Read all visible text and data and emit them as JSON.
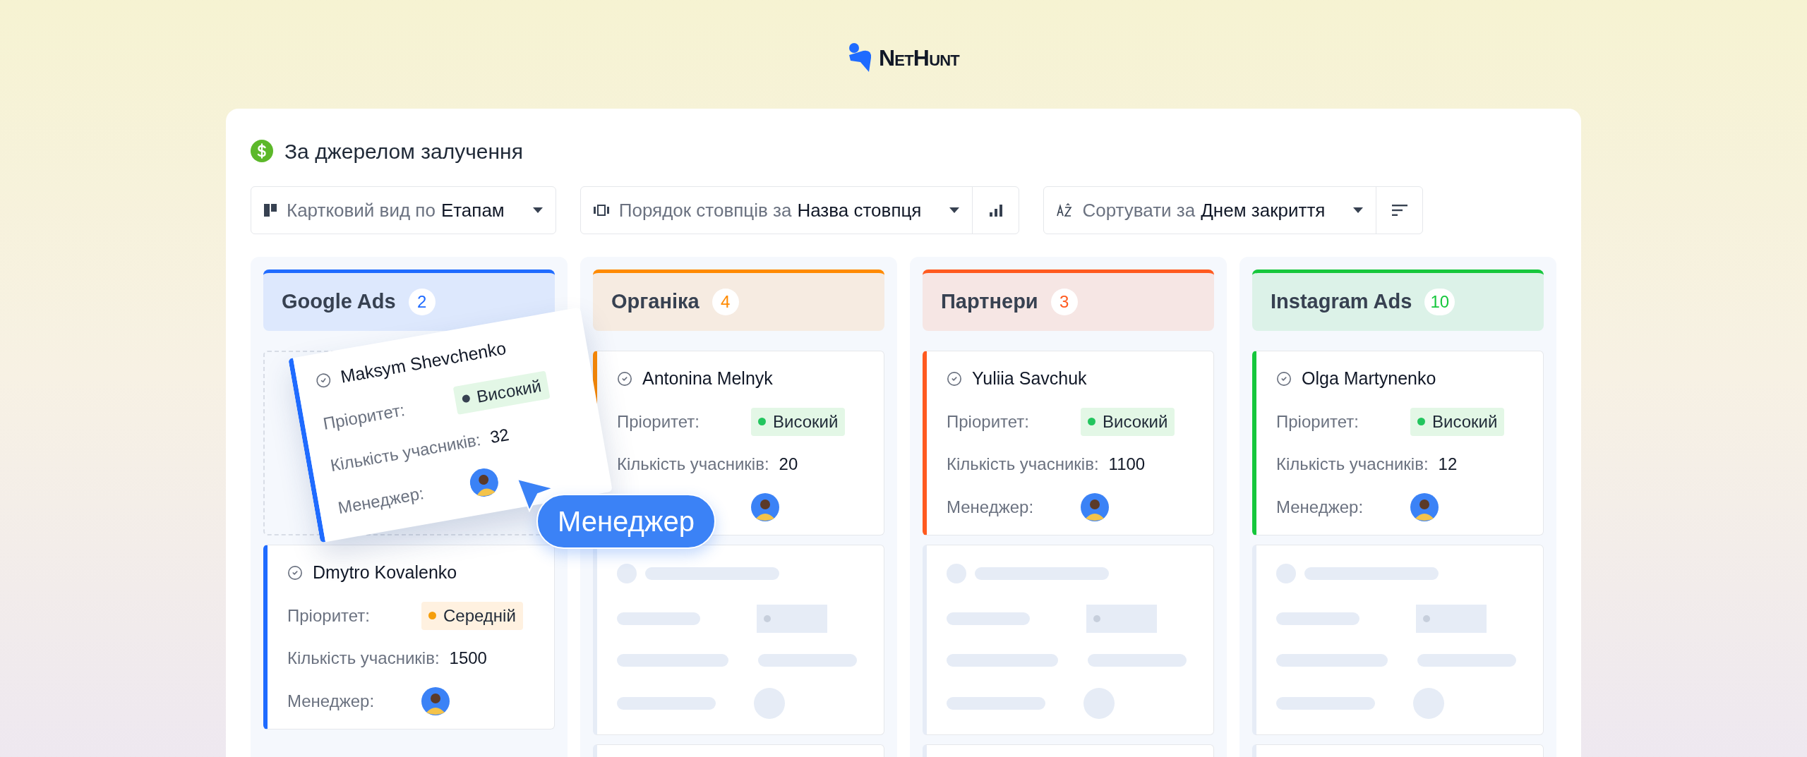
{
  "logo": {
    "text": "NetHunt"
  },
  "board": {
    "title": "За джерелом залучення",
    "toolbar": [
      {
        "kind": "view",
        "label": "Картковий вид по",
        "value": "Етапам"
      },
      {
        "kind": "columns",
        "label": "Порядок стовпців за",
        "value": "Назва стовпця"
      },
      {
        "kind": "sort",
        "label": "Сортувати за",
        "value": "Днем закриття"
      }
    ],
    "columns": [
      {
        "name": "Google Ads",
        "count": "2",
        "color": "#1f6bff",
        "cards": [
          {
            "kind": "drop-slot"
          },
          {
            "kind": "deal",
            "name": "Dmytro Kovalenko",
            "priority_label": "Пріоритет:",
            "priority": {
              "kind": "medium",
              "text": "Середній",
              "color": "#f59e0b"
            },
            "participants_label": "Кількість учасників:",
            "participants": "1500",
            "manager_label": "Менеджер:"
          }
        ]
      },
      {
        "name": "Органіка",
        "count": "4",
        "color": "#ff8a00",
        "cards": [
          {
            "kind": "deal",
            "name": "Antonina Melnyk",
            "priority_label": "Пріоритет:",
            "priority": {
              "kind": "high",
              "text": "Високий",
              "color": "#22c55e"
            },
            "participants_label": "Кількість учасників:",
            "participants": "20"
          },
          {
            "kind": "skeleton"
          },
          {
            "kind": "skeleton"
          }
        ]
      },
      {
        "name": "Партнери",
        "count": "3",
        "color": "#ff5a1f",
        "cards": [
          {
            "kind": "deal",
            "name": "Yuliia Savchuk",
            "priority_label": "Пріоритет:",
            "priority": {
              "kind": "high",
              "text": "Високий",
              "color": "#22c55e"
            },
            "participants_label": "Кількість учасників:",
            "participants": "1100",
            "manager_label": "Менеджер:"
          },
          {
            "kind": "skeleton"
          },
          {
            "kind": "skeleton"
          }
        ]
      },
      {
        "name": "Instagram Ads",
        "count": "10",
        "color": "#16c73c",
        "cards": [
          {
            "kind": "deal",
            "name": "Olga Martynenko",
            "priority_label": "Пріоритет:",
            "priority": {
              "kind": "high",
              "text": "Високий",
              "color": "#22c55e"
            },
            "participants_label": "Кількість учасників:",
            "participants": "12",
            "manager_label": "Менеджер:"
          },
          {
            "kind": "skeleton"
          },
          {
            "kind": "skeleton"
          }
        ]
      }
    ],
    "dragged_card": {
      "name": "Maksym Shevchenko",
      "color": "#1f6bff",
      "priority_label": "Пріоритет:",
      "priority": {
        "kind": "high",
        "text": "Високий",
        "color": "#374151"
      },
      "participants_label": "Кількість учасників:",
      "participants": "32",
      "manager_label": "Менеджер:"
    },
    "tooltip": "Менеджер"
  }
}
